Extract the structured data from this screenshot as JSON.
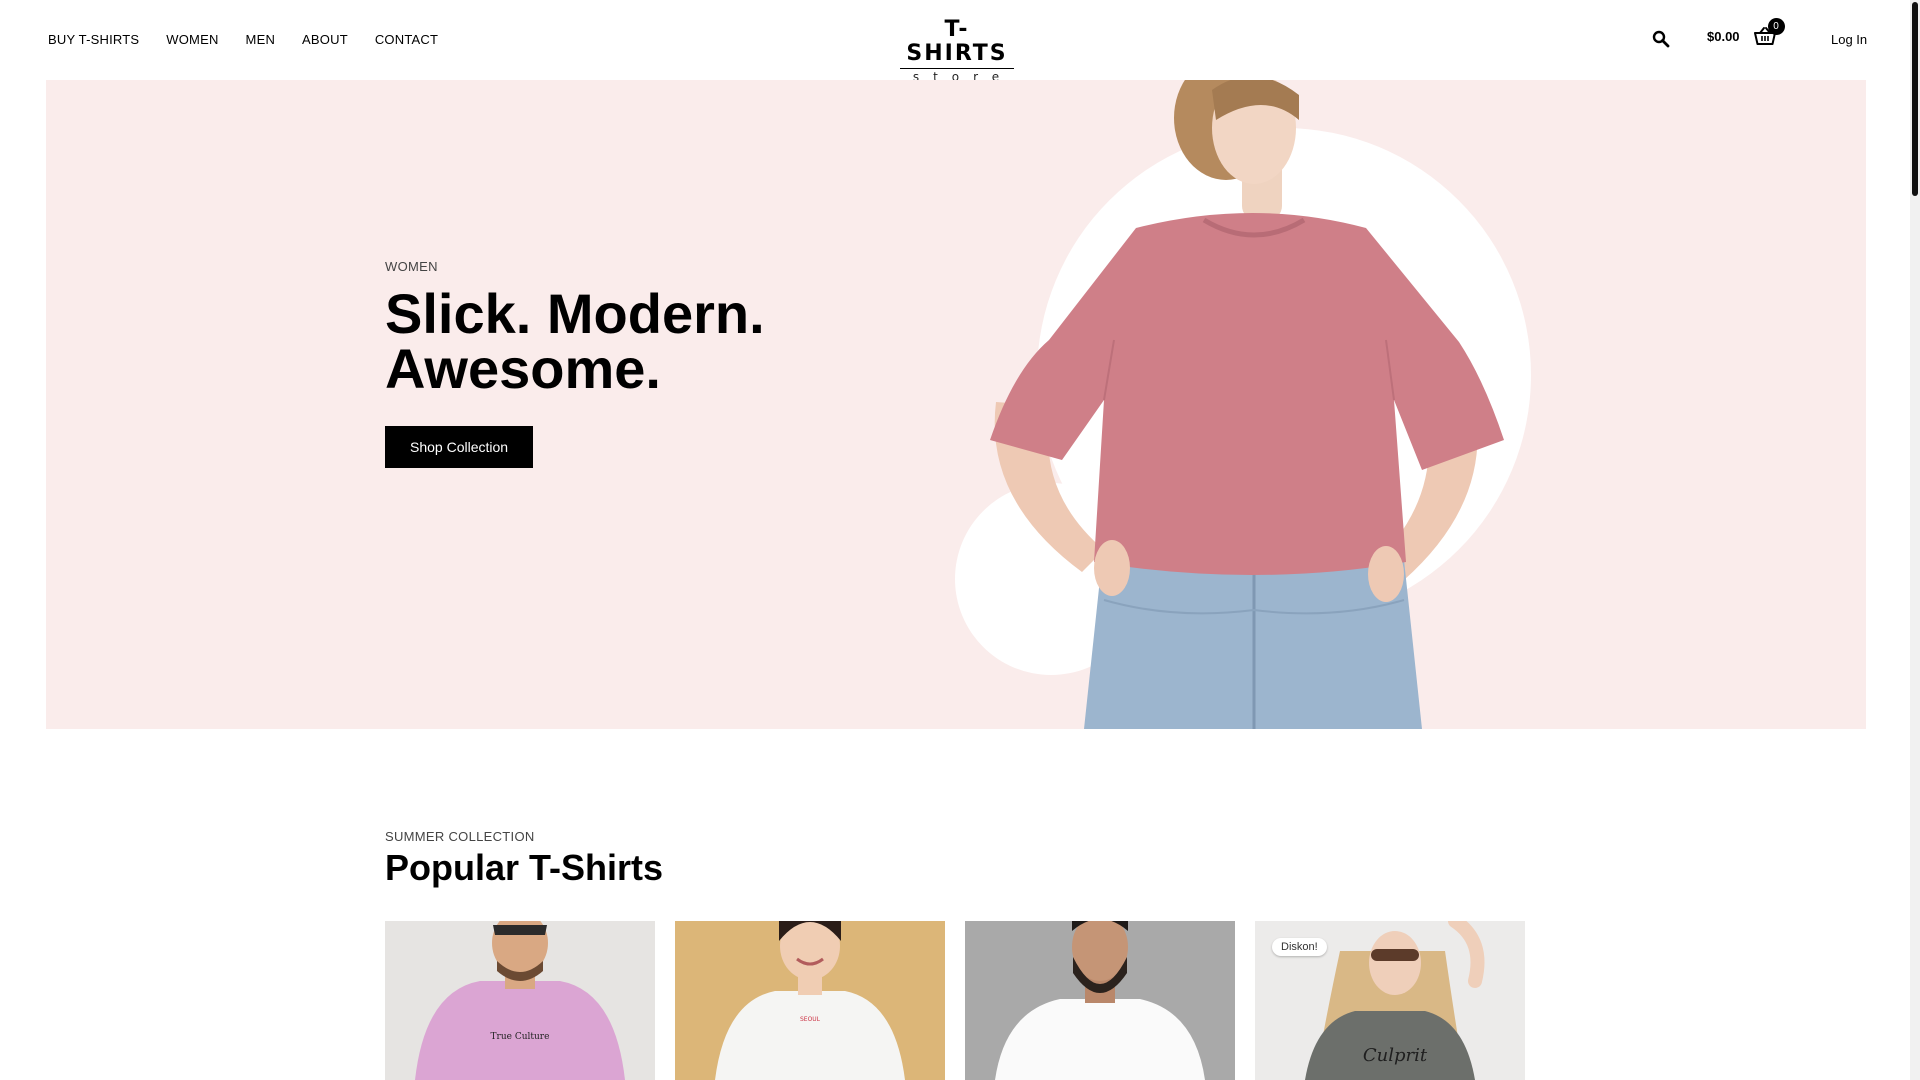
{
  "nav": {
    "items": [
      {
        "label": "BUY T-SHIRTS"
      },
      {
        "label": "WOMEN"
      },
      {
        "label": "MEN"
      },
      {
        "label": "ABOUT"
      },
      {
        "label": "CONTACT"
      }
    ]
  },
  "logo": {
    "title": "T-SHIRTS",
    "subtitle": "store"
  },
  "header": {
    "search_icon": "search-icon",
    "cart_total": "$0.00",
    "cart_icon": "basket-icon",
    "cart_count": "0",
    "login_label": "Log In"
  },
  "hero": {
    "eyebrow": "WOMEN",
    "title_line1": "Slick. Modern.",
    "title_line2": "Awesome.",
    "cta_label": "Shop Collection",
    "background_color": "#faeceb"
  },
  "collection": {
    "eyebrow": "SUMMER COLLECTION",
    "title": "Popular T-Shirts",
    "products": [
      {
        "image": "man-pink-tshirt",
        "badge": null
      },
      {
        "image": "woman-white-tshirt",
        "badge": null
      },
      {
        "image": "man-white-tshirt",
        "badge": null
      },
      {
        "image": "woman-grey-tshirt",
        "badge": "Diskon!"
      }
    ]
  }
}
